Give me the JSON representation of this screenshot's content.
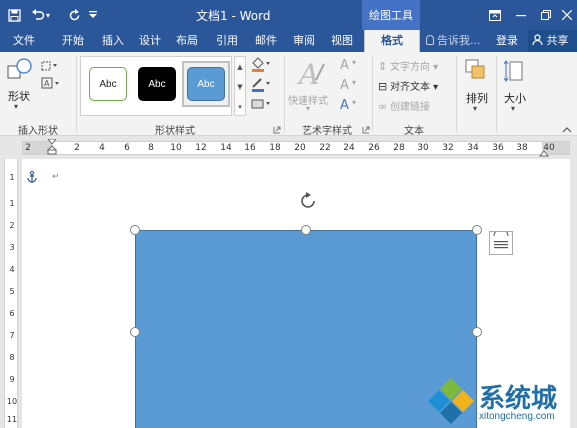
{
  "titlebar": {
    "doc_title": "文档1 - Word",
    "context_tool": "绘图工具",
    "bg_color": "#2b579a"
  },
  "tabs": [
    {
      "label": "文件"
    },
    {
      "label": "开始"
    },
    {
      "label": "插入"
    },
    {
      "label": "设计"
    },
    {
      "label": "布局"
    },
    {
      "label": "引用"
    },
    {
      "label": "邮件"
    },
    {
      "label": "审阅"
    },
    {
      "label": "视图"
    },
    {
      "label": "格式",
      "active": true
    }
  ],
  "tellme": "告诉我...",
  "account": {
    "login": "登录",
    "share": "共享"
  },
  "ribbon": {
    "insert_shapes": {
      "shape_label": "形状",
      "group_label": "插入形状"
    },
    "shape_styles": {
      "group_label": "形状样式",
      "styles": [
        {
          "label": "Abc",
          "variant": "outline-green"
        },
        {
          "label": "Abc",
          "variant": "black"
        },
        {
          "label": "Abc",
          "variant": "blue-selected"
        }
      ]
    },
    "wordart": {
      "quick_styles": "快速样式",
      "group_label": "艺术字样式"
    },
    "text": {
      "direction": "文字方向",
      "align": "对齐文本",
      "link": "创建链接",
      "group_label": "文本"
    },
    "arrange": {
      "label": "排列"
    },
    "size": {
      "label": "大小"
    }
  },
  "ruler": {
    "tab_selector": "L",
    "marks": [
      "2",
      "2",
      "4",
      "6",
      "8",
      "10",
      "12",
      "14",
      "16",
      "18",
      "20",
      "22",
      "24",
      "26",
      "28",
      "30",
      "32",
      "34",
      "36",
      "38",
      "40"
    ]
  },
  "vruler": {
    "marks": [
      "1",
      "1",
      "2",
      "3",
      "4",
      "5",
      "6",
      "7",
      "8",
      "9",
      "10",
      "11"
    ]
  },
  "shape": {
    "fill": "#5b9bd5"
  },
  "watermark": {
    "brand": "系统城",
    "url": "xitongcheng.com"
  }
}
